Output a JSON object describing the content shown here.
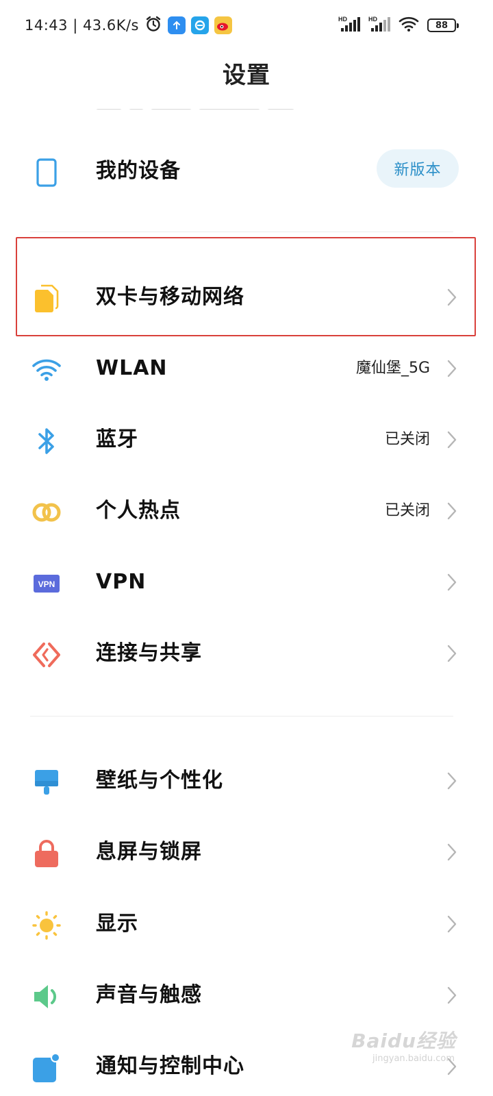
{
  "status_bar": {
    "time_speed": "14:43 | 43.6K/s",
    "network_left": "HD",
    "network_right": "HD",
    "battery": "88"
  },
  "header": {
    "title": "设置"
  },
  "device": {
    "label": "我的设备",
    "badge": "新版本"
  },
  "rows": [
    {
      "label": "双卡与移动网络",
      "value": "",
      "icon": "sim-card-icon"
    },
    {
      "label": "WLAN",
      "value": "魔仙堡_5G",
      "icon": "wifi-icon"
    },
    {
      "label": "蓝牙",
      "value": "已关闭",
      "icon": "bluetooth-icon"
    },
    {
      "label": "个人热点",
      "value": "已关闭",
      "icon": "hotspot-icon"
    },
    {
      "label": "VPN",
      "value": "",
      "icon": "vpn-icon"
    },
    {
      "label": "连接与共享",
      "value": "",
      "icon": "connection-sharing-icon"
    },
    {
      "label": "壁纸与个性化",
      "value": "",
      "icon": "wallpaper-brush-icon"
    },
    {
      "label": "息屏与锁屏",
      "value": "",
      "icon": "lock-icon"
    },
    {
      "label": "显示",
      "value": "",
      "icon": "sun-icon"
    },
    {
      "label": "声音与触感",
      "value": "",
      "icon": "speaker-icon"
    },
    {
      "label": "通知与控制中心",
      "value": "",
      "icon": "notification-icon"
    }
  ],
  "vpn_icon_text": "VPN",
  "watermark": {
    "main": "Baidu经验",
    "sub": "jingyan.baidu.com"
  },
  "colors": {
    "accent_blue": "#2b8fc8",
    "sim_yellow": "#fbc02d",
    "wifi_blue": "#3ba0e6",
    "hotspot_yellow": "#f2c24b",
    "vpn_purple": "#5b6bdc",
    "share_red": "#ef6b5b",
    "lock_red": "#ee6b5e",
    "sound_green": "#5cc98a",
    "highlight_red": "#d9403b"
  }
}
